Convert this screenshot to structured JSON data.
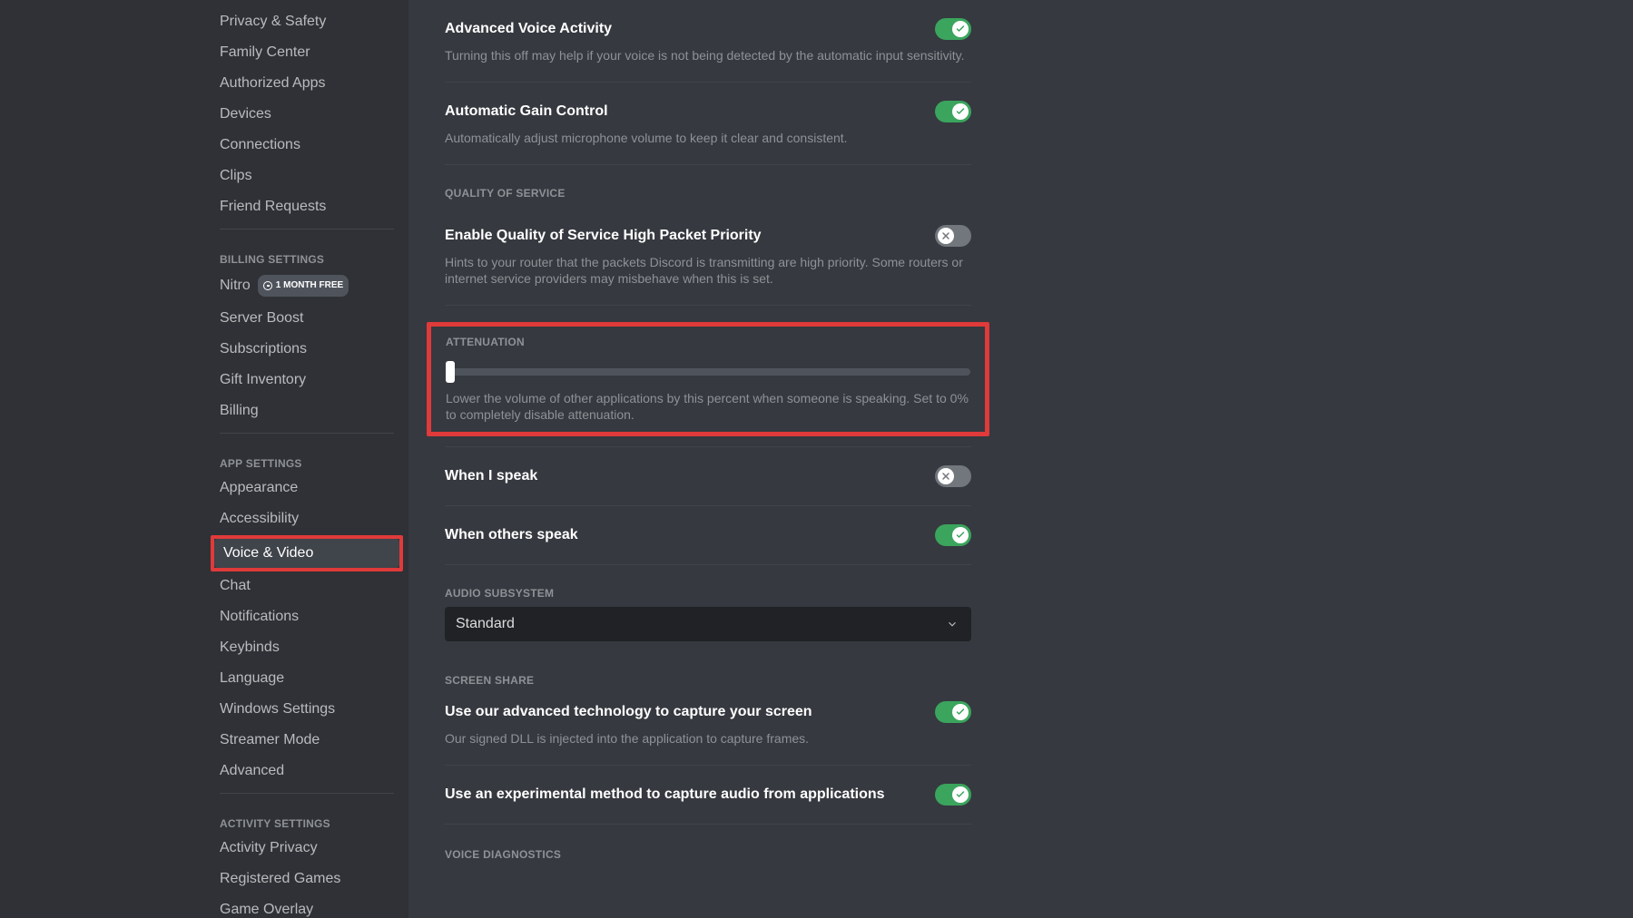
{
  "sidebar": {
    "user_settings_items": [
      {
        "label": "Privacy & Safety"
      },
      {
        "label": "Family Center"
      },
      {
        "label": "Authorized Apps"
      },
      {
        "label": "Devices"
      },
      {
        "label": "Connections"
      },
      {
        "label": "Clips"
      },
      {
        "label": "Friend Requests"
      }
    ],
    "billing_header": "Billing Settings",
    "billing_items": [
      {
        "label": "Nitro",
        "badge": "1 MONTH FREE"
      },
      {
        "label": "Server Boost"
      },
      {
        "label": "Subscriptions"
      },
      {
        "label": "Gift Inventory"
      },
      {
        "label": "Billing"
      }
    ],
    "app_header": "App Settings",
    "app_items": [
      {
        "label": "Appearance"
      },
      {
        "label": "Accessibility"
      },
      {
        "label": "Voice & Video",
        "active": true
      },
      {
        "label": "Chat"
      },
      {
        "label": "Notifications"
      },
      {
        "label": "Keybinds"
      },
      {
        "label": "Language"
      },
      {
        "label": "Windows Settings"
      },
      {
        "label": "Streamer Mode"
      },
      {
        "label": "Advanced"
      }
    ],
    "activity_header": "Activity Settings",
    "activity_items": [
      {
        "label": "Activity Privacy"
      },
      {
        "label": "Registered Games"
      },
      {
        "label": "Game Overlay"
      }
    ]
  },
  "content": {
    "advanced_voice": {
      "title": "Advanced Voice Activity",
      "desc": "Turning this off may help if your voice is not being detected by the automatic input sensitivity.",
      "on": true
    },
    "agc": {
      "title": "Automatic Gain Control",
      "desc": "Automatically adjust microphone volume to keep it clear and consistent.",
      "on": true
    },
    "qos_header": "Quality of Service",
    "qos": {
      "title": "Enable Quality of Service High Packet Priority",
      "desc": "Hints to your router that the packets Discord is transmitting are high priority. Some routers or internet service providers may misbehave when this is set.",
      "on": false
    },
    "attenuation_header": "Attenuation",
    "attenuation": {
      "desc": "Lower the volume of other applications by this percent when someone is speaking. Set to 0% to completely disable attenuation.",
      "value_pct": 0
    },
    "when_i_speak": {
      "title": "When I speak",
      "on": false
    },
    "when_others_speak": {
      "title": "When others speak",
      "on": true
    },
    "audio_subsystem_header": "Audio Subsystem",
    "audio_subsystem": {
      "value": "Standard"
    },
    "screen_share_header": "Screen Share",
    "ss_advanced": {
      "title": "Use our advanced technology to capture your screen",
      "desc": "Our signed DLL is injected into the application to capture frames.",
      "on": true
    },
    "ss_experimental": {
      "title": "Use an experimental method to capture audio from applications",
      "on": true
    },
    "voice_diag_header": "Voice Diagnostics"
  }
}
